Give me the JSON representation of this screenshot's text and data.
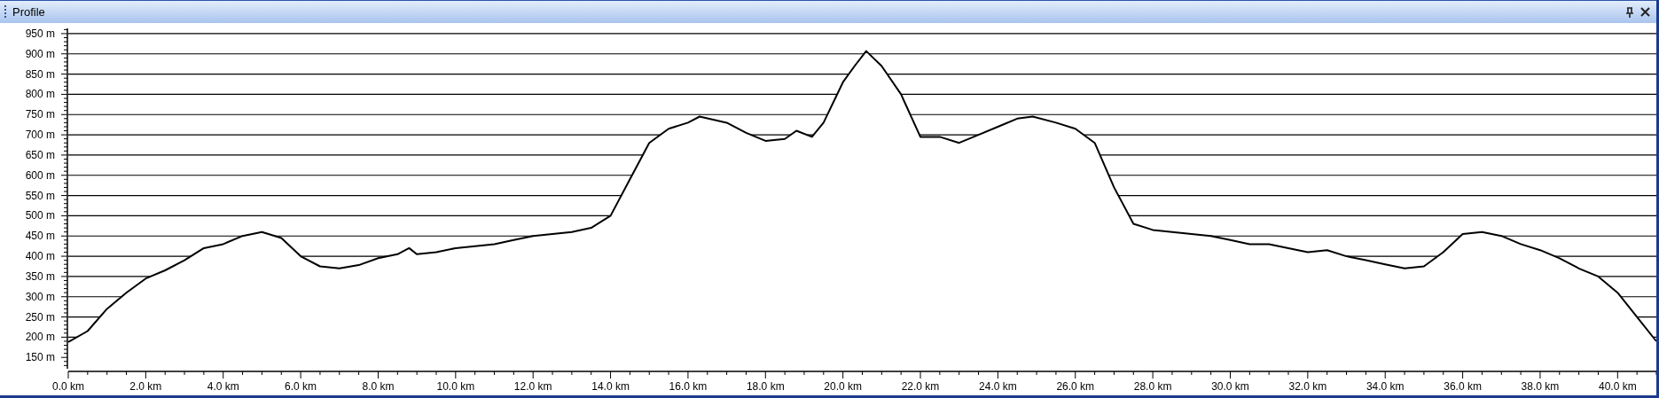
{
  "window": {
    "title": "Profile"
  },
  "profile": {
    "chart_data": {
      "type": "area",
      "grid": true,
      "xlim": [
        0,
        41
      ],
      "ylim": [
        122,
        963
      ],
      "xticks": [
        {
          "value": 0,
          "label": "0.0 km"
        },
        {
          "value": 2,
          "label": "2.0 km"
        },
        {
          "value": 4,
          "label": "4.0 km"
        },
        {
          "value": 6,
          "label": "6.0 km"
        },
        {
          "value": 8,
          "label": "8.0 km"
        },
        {
          "value": 10,
          "label": "10.0 km"
        },
        {
          "value": 12,
          "label": "12.0 km"
        },
        {
          "value": 14,
          "label": "14.0 km"
        },
        {
          "value": 16,
          "label": "16.0 km"
        },
        {
          "value": 18,
          "label": "18.0 km"
        },
        {
          "value": 20,
          "label": "20.0 km"
        },
        {
          "value": 22,
          "label": "22.0 km"
        },
        {
          "value": 24,
          "label": "24.0 km"
        },
        {
          "value": 26,
          "label": "26.0 km"
        },
        {
          "value": 28,
          "label": "28.0 km"
        },
        {
          "value": 30,
          "label": "30.0 km"
        },
        {
          "value": 32,
          "label": "32.0 km"
        },
        {
          "value": 34,
          "label": "34.0 km"
        },
        {
          "value": 36,
          "label": "36.0 km"
        },
        {
          "value": 38,
          "label": "38.0 km"
        },
        {
          "value": 40,
          "label": "40.0 km"
        }
      ],
      "yticks": [
        {
          "value": 150,
          "label": "150 m"
        },
        {
          "value": 200,
          "label": "200 m"
        },
        {
          "value": 250,
          "label": "250 m"
        },
        {
          "value": 300,
          "label": "300 m"
        },
        {
          "value": 350,
          "label": "350 m"
        },
        {
          "value": 400,
          "label": "400 m"
        },
        {
          "value": 450,
          "label": "450 m"
        },
        {
          "value": 500,
          "label": "500 m"
        },
        {
          "value": 550,
          "label": "550 m"
        },
        {
          "value": 600,
          "label": "600 m"
        },
        {
          "value": 650,
          "label": "650 m"
        },
        {
          "value": 700,
          "label": "700 m"
        },
        {
          "value": 750,
          "label": "750 m"
        },
        {
          "value": 800,
          "label": "800 m"
        },
        {
          "value": 850,
          "label": "850 m"
        },
        {
          "value": 900,
          "label": "900 m"
        },
        {
          "value": 950,
          "label": "950 m"
        }
      ],
      "x": [
        0,
        0.5,
        1,
        1.5,
        2,
        2.5,
        3,
        3.5,
        4,
        4.5,
        5,
        5.5,
        6,
        6.5,
        7,
        7.5,
        8,
        8.5,
        8.8,
        9,
        9.5,
        10,
        10.5,
        11,
        11.5,
        12,
        12.5,
        13,
        13.5,
        14,
        14.5,
        15,
        15.5,
        16,
        16.3,
        17,
        17.5,
        18,
        18.5,
        18.8,
        19.2,
        19.5,
        20,
        20.3,
        20.6,
        21,
        21.5,
        22,
        22.5,
        23,
        23.5,
        24,
        24.5,
        24.9,
        25.5,
        26,
        26.5,
        27,
        27.5,
        28,
        28.5,
        29,
        29.5,
        30,
        30.5,
        31,
        31.5,
        32,
        32.5,
        33,
        33.5,
        34,
        34.5,
        35,
        35.5,
        36,
        36.5,
        37,
        37.5,
        38,
        38.5,
        39,
        39.5,
        40,
        40.5,
        41
      ],
      "series": [
        {
          "color": "#000000",
          "values": [
            188,
            215,
            270,
            310,
            345,
            365,
            390,
            420,
            430,
            450,
            460,
            445,
            400,
            375,
            370,
            378,
            395,
            405,
            420,
            405,
            410,
            420,
            425,
            430,
            440,
            450,
            455,
            460,
            470,
            500,
            590,
            680,
            715,
            730,
            745,
            730,
            705,
            685,
            690,
            710,
            695,
            730,
            830,
            870,
            907,
            870,
            800,
            695,
            695,
            680,
            700,
            720,
            740,
            745,
            730,
            715,
            680,
            570,
            480,
            465,
            460,
            455,
            450,
            440,
            430,
            430,
            420,
            410,
            415,
            400,
            390,
            380,
            370,
            375,
            410,
            455,
            460,
            450,
            430,
            415,
            395,
            370,
            350,
            310,
            250,
            190
          ]
        }
      ]
    }
  }
}
